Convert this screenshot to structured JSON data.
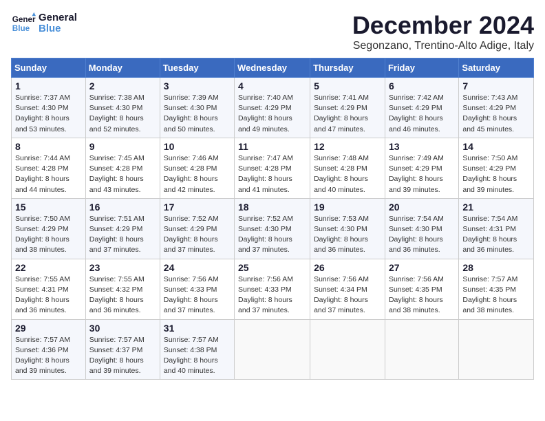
{
  "header": {
    "logo_line1": "General",
    "logo_line2": "Blue",
    "month": "December 2024",
    "location": "Segonzano, Trentino-Alto Adige, Italy"
  },
  "weekdays": [
    "Sunday",
    "Monday",
    "Tuesday",
    "Wednesday",
    "Thursday",
    "Friday",
    "Saturday"
  ],
  "weeks": [
    [
      {
        "day": "1",
        "sunrise": "7:37 AM",
        "sunset": "4:30 PM",
        "daylight": "8 hours and 53 minutes."
      },
      {
        "day": "2",
        "sunrise": "7:38 AM",
        "sunset": "4:30 PM",
        "daylight": "8 hours and 52 minutes."
      },
      {
        "day": "3",
        "sunrise": "7:39 AM",
        "sunset": "4:30 PM",
        "daylight": "8 hours and 50 minutes."
      },
      {
        "day": "4",
        "sunrise": "7:40 AM",
        "sunset": "4:29 PM",
        "daylight": "8 hours and 49 minutes."
      },
      {
        "day": "5",
        "sunrise": "7:41 AM",
        "sunset": "4:29 PM",
        "daylight": "8 hours and 47 minutes."
      },
      {
        "day": "6",
        "sunrise": "7:42 AM",
        "sunset": "4:29 PM",
        "daylight": "8 hours and 46 minutes."
      },
      {
        "day": "7",
        "sunrise": "7:43 AM",
        "sunset": "4:29 PM",
        "daylight": "8 hours and 45 minutes."
      }
    ],
    [
      {
        "day": "8",
        "sunrise": "7:44 AM",
        "sunset": "4:28 PM",
        "daylight": "8 hours and 44 minutes."
      },
      {
        "day": "9",
        "sunrise": "7:45 AM",
        "sunset": "4:28 PM",
        "daylight": "8 hours and 43 minutes."
      },
      {
        "day": "10",
        "sunrise": "7:46 AM",
        "sunset": "4:28 PM",
        "daylight": "8 hours and 42 minutes."
      },
      {
        "day": "11",
        "sunrise": "7:47 AM",
        "sunset": "4:28 PM",
        "daylight": "8 hours and 41 minutes."
      },
      {
        "day": "12",
        "sunrise": "7:48 AM",
        "sunset": "4:28 PM",
        "daylight": "8 hours and 40 minutes."
      },
      {
        "day": "13",
        "sunrise": "7:49 AM",
        "sunset": "4:29 PM",
        "daylight": "8 hours and 39 minutes."
      },
      {
        "day": "14",
        "sunrise": "7:50 AM",
        "sunset": "4:29 PM",
        "daylight": "8 hours and 39 minutes."
      }
    ],
    [
      {
        "day": "15",
        "sunrise": "7:50 AM",
        "sunset": "4:29 PM",
        "daylight": "8 hours and 38 minutes."
      },
      {
        "day": "16",
        "sunrise": "7:51 AM",
        "sunset": "4:29 PM",
        "daylight": "8 hours and 37 minutes."
      },
      {
        "day": "17",
        "sunrise": "7:52 AM",
        "sunset": "4:29 PM",
        "daylight": "8 hours and 37 minutes."
      },
      {
        "day": "18",
        "sunrise": "7:52 AM",
        "sunset": "4:30 PM",
        "daylight": "8 hours and 37 minutes."
      },
      {
        "day": "19",
        "sunrise": "7:53 AM",
        "sunset": "4:30 PM",
        "daylight": "8 hours and 36 minutes."
      },
      {
        "day": "20",
        "sunrise": "7:54 AM",
        "sunset": "4:30 PM",
        "daylight": "8 hours and 36 minutes."
      },
      {
        "day": "21",
        "sunrise": "7:54 AM",
        "sunset": "4:31 PM",
        "daylight": "8 hours and 36 minutes."
      }
    ],
    [
      {
        "day": "22",
        "sunrise": "7:55 AM",
        "sunset": "4:31 PM",
        "daylight": "8 hours and 36 minutes."
      },
      {
        "day": "23",
        "sunrise": "7:55 AM",
        "sunset": "4:32 PM",
        "daylight": "8 hours and 36 minutes."
      },
      {
        "day": "24",
        "sunrise": "7:56 AM",
        "sunset": "4:33 PM",
        "daylight": "8 hours and 37 minutes."
      },
      {
        "day": "25",
        "sunrise": "7:56 AM",
        "sunset": "4:33 PM",
        "daylight": "8 hours and 37 minutes."
      },
      {
        "day": "26",
        "sunrise": "7:56 AM",
        "sunset": "4:34 PM",
        "daylight": "8 hours and 37 minutes."
      },
      {
        "day": "27",
        "sunrise": "7:56 AM",
        "sunset": "4:35 PM",
        "daylight": "8 hours and 38 minutes."
      },
      {
        "day": "28",
        "sunrise": "7:57 AM",
        "sunset": "4:35 PM",
        "daylight": "8 hours and 38 minutes."
      }
    ],
    [
      {
        "day": "29",
        "sunrise": "7:57 AM",
        "sunset": "4:36 PM",
        "daylight": "8 hours and 39 minutes."
      },
      {
        "day": "30",
        "sunrise": "7:57 AM",
        "sunset": "4:37 PM",
        "daylight": "8 hours and 39 minutes."
      },
      {
        "day": "31",
        "sunrise": "7:57 AM",
        "sunset": "4:38 PM",
        "daylight": "8 hours and 40 minutes."
      },
      null,
      null,
      null,
      null
    ]
  ],
  "labels": {
    "sunrise": "Sunrise:",
    "sunset": "Sunset:",
    "daylight": "Daylight:"
  }
}
